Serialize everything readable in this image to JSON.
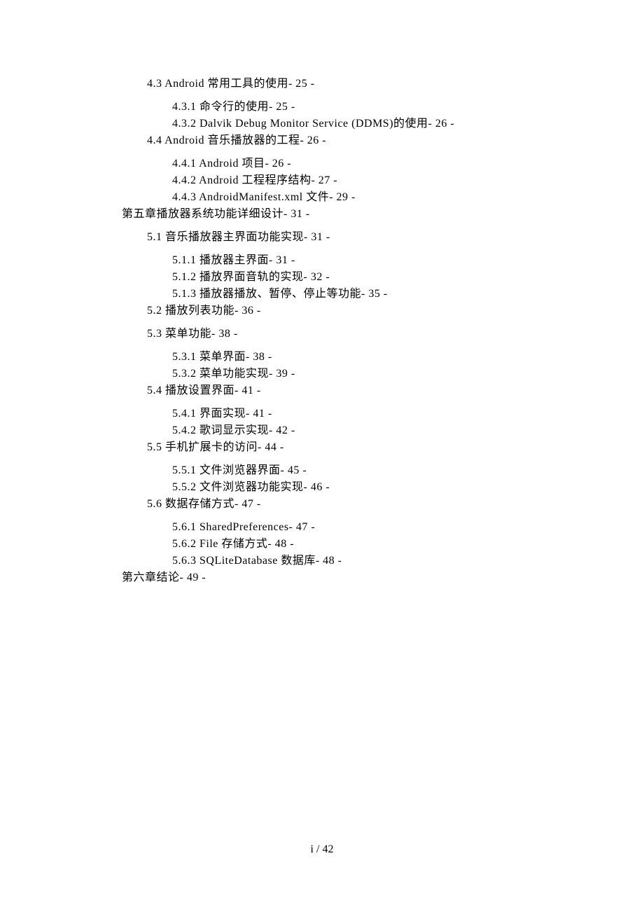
{
  "toc": [
    {
      "level": 1,
      "text": "4.3 Android 常用工具的使用- 25 -",
      "spacer": false
    },
    {
      "level": -1,
      "text": "",
      "spacer": true
    },
    {
      "level": 2,
      "text": "4.3.1 命令行的使用- 25 -",
      "spacer": false
    },
    {
      "level": 2,
      "text": "4.3.2 Dalvik Debug Monitor Service (DDMS)的使用- 26 -",
      "spacer": false
    },
    {
      "level": 1,
      "text": "4.4 Android 音乐播放器的工程- 26 -",
      "spacer": false
    },
    {
      "level": -1,
      "text": "",
      "spacer": true
    },
    {
      "level": 2,
      "text": "4.4.1 Android 项目- 26 -",
      "spacer": false
    },
    {
      "level": 2,
      "text": "4.4.2 Android 工程程序结构- 27 -",
      "spacer": false
    },
    {
      "level": 2,
      "text": "4.4.3 AndroidManifest.xml 文件- 29 -",
      "spacer": false
    },
    {
      "level": 0,
      "text": "第五章播放器系统功能详细设计- 31 -",
      "spacer": false
    },
    {
      "level": -1,
      "text": "",
      "spacer": true
    },
    {
      "level": 1,
      "text": "5.1 音乐播放器主界面功能实现- 31 -",
      "spacer": false
    },
    {
      "level": -1,
      "text": "",
      "spacer": true
    },
    {
      "level": 2,
      "text": "5.1.1 播放器主界面- 31 -",
      "spacer": false
    },
    {
      "level": 2,
      "text": "5.1.2 播放界面音轨的实现- 32 -",
      "spacer": false
    },
    {
      "level": 2,
      "text": "5.1.3 播放器播放、暂停、停止等功能- 35 -",
      "spacer": false
    },
    {
      "level": 1,
      "text": "5.2 播放列表功能- 36 -",
      "spacer": false
    },
    {
      "level": -1,
      "text": "",
      "spacer": true
    },
    {
      "level": 1,
      "text": "5.3 菜单功能- 38 -",
      "spacer": false
    },
    {
      "level": -1,
      "text": "",
      "spacer": true
    },
    {
      "level": 2,
      "text": "5.3.1 菜单界面- 38 -",
      "spacer": false
    },
    {
      "level": 2,
      "text": "5.3.2 菜单功能实现- 39 -",
      "spacer": false
    },
    {
      "level": 1,
      "text": "5.4 播放设置界面- 41 -",
      "spacer": false
    },
    {
      "level": -1,
      "text": "",
      "spacer": true
    },
    {
      "level": 2,
      "text": "5.4.1 界面实现- 41 -",
      "spacer": false
    },
    {
      "level": 2,
      "text": "5.4.2 歌词显示实现- 42 -",
      "spacer": false
    },
    {
      "level": 1,
      "text": "5.5 手机扩展卡的访问- 44 -",
      "spacer": false
    },
    {
      "level": -1,
      "text": "",
      "spacer": true
    },
    {
      "level": 2,
      "text": "5.5.1 文件浏览器界面- 45 -",
      "spacer": false
    },
    {
      "level": 2,
      "text": "5.5.2 文件浏览器功能实现- 46 -",
      "spacer": false
    },
    {
      "level": 1,
      "text": "5.6 数据存储方式- 47 -",
      "spacer": false
    },
    {
      "level": -1,
      "text": "",
      "spacer": true
    },
    {
      "level": 2,
      "text": "5.6.1 SharedPreferences- 47 -",
      "spacer": false
    },
    {
      "level": 2,
      "text": "5.6.2 File 存储方式- 48 -",
      "spacer": false
    },
    {
      "level": 2,
      "text": "5.6.3 SQLiteDatabase 数据库- 48 -",
      "spacer": false
    },
    {
      "level": 0,
      "text": "第六章结论- 49 -",
      "spacer": false
    }
  ],
  "footer": "i / 42"
}
